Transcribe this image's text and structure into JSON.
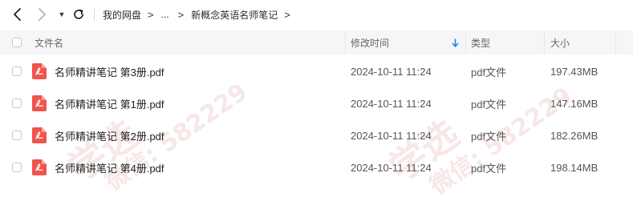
{
  "breadcrumb": {
    "items": [
      "我的网盘",
      "...",
      "新概念英语名师笔记"
    ],
    "separator": ">"
  },
  "columns": {
    "name": "文件名",
    "modified": "修改时间",
    "type": "类型",
    "size": "大小",
    "sort_icon": "sort-down-arrow-icon"
  },
  "files": [
    {
      "name": "名师精讲笔记 第3册.pdf",
      "modified": "2024-10-11 11:24",
      "type": "pdf文件",
      "size": "197.43MB"
    },
    {
      "name": "名师精讲笔记 第1册.pdf",
      "modified": "2024-10-11 11:24",
      "type": "pdf文件",
      "size": "147.16MB"
    },
    {
      "name": "名师精讲笔记 第2册.pdf",
      "modified": "2024-10-11 11:24",
      "type": "pdf文件",
      "size": "182.26MB"
    },
    {
      "name": "名师精讲笔记 第4册.pdf",
      "modified": "2024-10-11 11:24",
      "type": "pdf文件",
      "size": "198.14MB"
    }
  ],
  "watermarks": [
    {
      "label": "学选",
      "sub": "微信: 582229"
    },
    {
      "label": "学选",
      "sub": "微信: 582229"
    }
  ],
  "colors": {
    "accent": "#1e88e5",
    "pdf_red": "#f0544e",
    "header_bg": "#f5f6f8"
  }
}
